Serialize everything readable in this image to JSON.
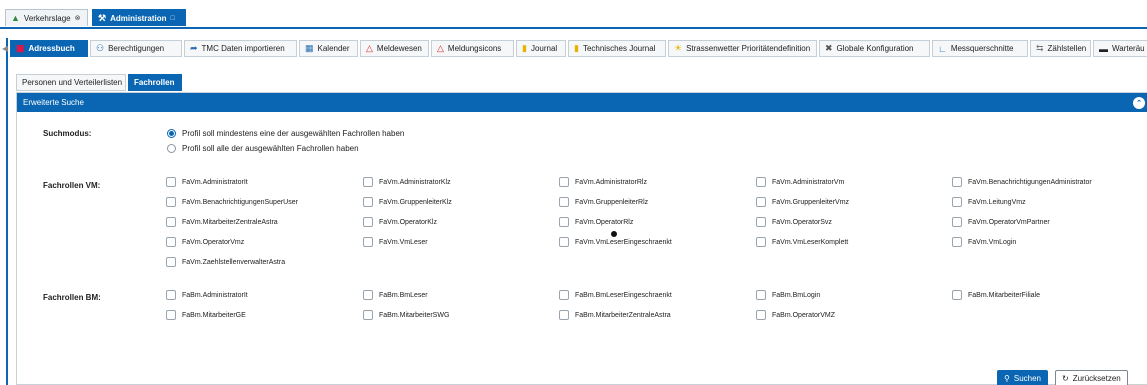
{
  "window_tabs": [
    {
      "label": "Verkehrslage",
      "icon": "car-icon"
    },
    {
      "label": "Administration",
      "icon": "tools-icon"
    }
  ],
  "module_tabs": [
    {
      "label": "Adressbuch"
    },
    {
      "label": "Berechtigungen"
    },
    {
      "label": "TMC Daten importieren"
    },
    {
      "label": "Kalender"
    },
    {
      "label": "Meldewesen"
    },
    {
      "label": "Meldungsicons"
    },
    {
      "label": "Journal"
    },
    {
      "label": "Technisches Journal"
    },
    {
      "label": "Strassenwetter Prioritätendefinition"
    },
    {
      "label": "Globale Konfiguration"
    },
    {
      "label": "Messquerschnitte"
    },
    {
      "label": "Zählstellen"
    },
    {
      "label": "Warteräu"
    }
  ],
  "sub_tabs": [
    {
      "label": "Personen und Verteilerlisten"
    },
    {
      "label": "Fachrollen"
    }
  ],
  "panel": {
    "title": "Erweiterte Suche"
  },
  "search_mode": {
    "label": "Suchmodus:",
    "options": [
      {
        "label": "Profil soll mindestens eine der ausgewählten Fachrollen haben",
        "selected": true
      },
      {
        "label": "Profil soll alle der ausgewählten Fachrollen haben",
        "selected": false
      }
    ]
  },
  "fachrollen_vm": {
    "label": "Fachrollen VM:",
    "items": [
      "FaVm.AdministratorIt",
      "FaVm.AdministratorKlz",
      "FaVm.AdministratorRlz",
      "FaVm.AdministratorVm",
      "FaVm.BenachrichtigungenAdministrator",
      "FaVm.BenachrichtigungenSuperUser",
      "FaVm.GruppenleiterKlz",
      "FaVm.GruppenleiterRlz",
      "FaVm.GruppenleiterVmz",
      "FaVm.LeitungVmz",
      "FaVm.MitarbeiterZentraleAstra",
      "FaVm.OperatorKlz",
      "FaVm.OperatorRlz",
      "FaVm.OperatorSvz",
      "FaVm.OperatorVmPartner",
      "FaVm.OperatorVmz",
      "FaVm.VmLeser",
      "FaVm.VmLeserEingeschraenkt",
      "FaVm.VmLeserKomplett",
      "FaVm.VmLogin",
      "FaVm.ZaehlstellenverwalterAstra"
    ]
  },
  "fachrollen_bm": {
    "label": "Fachrollen BM:",
    "items": [
      "FaBm.AdministratorIt",
      "FaBm.BmLeser",
      "FaBm.BmLeserEingeschraenkt",
      "FaBm.BmLogin",
      "FaBm.MitarbeiterFiliale",
      "FaBm.MitarbeiterGE",
      "FaBm.MitarbeiterSWG",
      "FaBm.MitarbeiterZentraleAstra",
      "FaBm.OperatorVMZ"
    ]
  },
  "actions": {
    "search_label": "Suchen",
    "reset_label": "Zurücksetzen"
  },
  "colors": {
    "accent": "#0a66b2"
  }
}
